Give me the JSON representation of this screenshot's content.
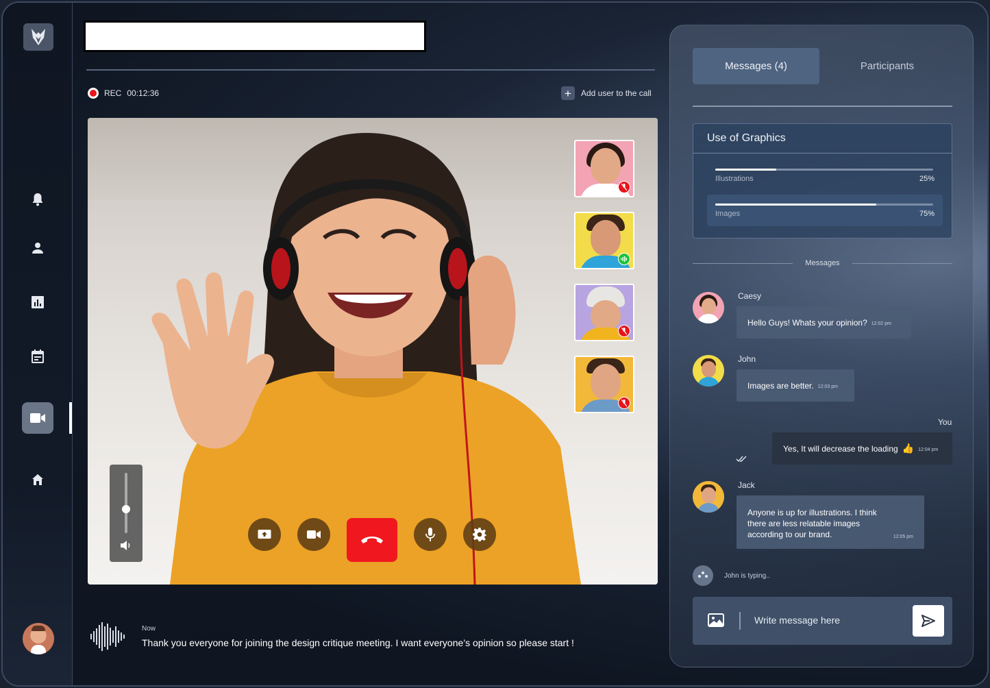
{
  "header": {
    "rec_label": "REC",
    "rec_time": "00:12:36",
    "add_user_label": "Add user to the call"
  },
  "sidebar": {
    "items": [
      {
        "name": "notifications",
        "icon": "bell-icon"
      },
      {
        "name": "profile",
        "icon": "user-icon"
      },
      {
        "name": "analytics",
        "icon": "chart-icon"
      },
      {
        "name": "calendar",
        "icon": "calendar-icon"
      },
      {
        "name": "video-call",
        "icon": "video-icon",
        "active": true
      },
      {
        "name": "home",
        "icon": "home-icon"
      }
    ]
  },
  "video": {
    "volume": 0.5,
    "participants": [
      {
        "name": "woman-pink",
        "muted": true
      },
      {
        "name": "man-yellow",
        "speaking": true
      },
      {
        "name": "woman-beanie",
        "muted": true
      },
      {
        "name": "man-glasses",
        "muted": true
      }
    ],
    "controls": [
      "share-screen",
      "camera",
      "end-call",
      "microphone",
      "settings"
    ]
  },
  "caption": {
    "time": "Now",
    "text": "Thank you everyone for joining the design critique meeting. I want everyone’s opinion so please start !"
  },
  "panel": {
    "tabs": [
      {
        "label": "Messages (4)",
        "active": true
      },
      {
        "label": "Participants",
        "active": false
      }
    ],
    "poll": {
      "title": "Use of Graphics",
      "options": [
        {
          "label": "Illustrations",
          "percent": "25%",
          "value": 0.25,
          "selected": false
        },
        {
          "label": "Images",
          "percent": "75%",
          "value": 0.75,
          "selected": true
        }
      ]
    },
    "messages_label": "Messages",
    "messages": [
      {
        "sender": "Caesy",
        "text": "Hello Guys! Whats your opinion?",
        "time": "12:02 pm"
      },
      {
        "sender": "John",
        "text": "Images are better.",
        "time": "12:03 pm"
      },
      {
        "sender": "You",
        "text": "Yes, It will decrease the loading",
        "emoji": "👍",
        "time": "12:04 pm"
      },
      {
        "sender": "Jack",
        "text": "Anyone is up for illustrations. I think there are less relatable images according to our brand.",
        "time": "12:05 pm"
      }
    ],
    "typing": "John is typing..",
    "composer_placeholder": "Write message here"
  },
  "colors": {
    "accent": "#4e6481",
    "end_call": "#f0171f",
    "rec": "#e8141c",
    "speaking": "#1fc23a",
    "muted": "#e8141c"
  }
}
